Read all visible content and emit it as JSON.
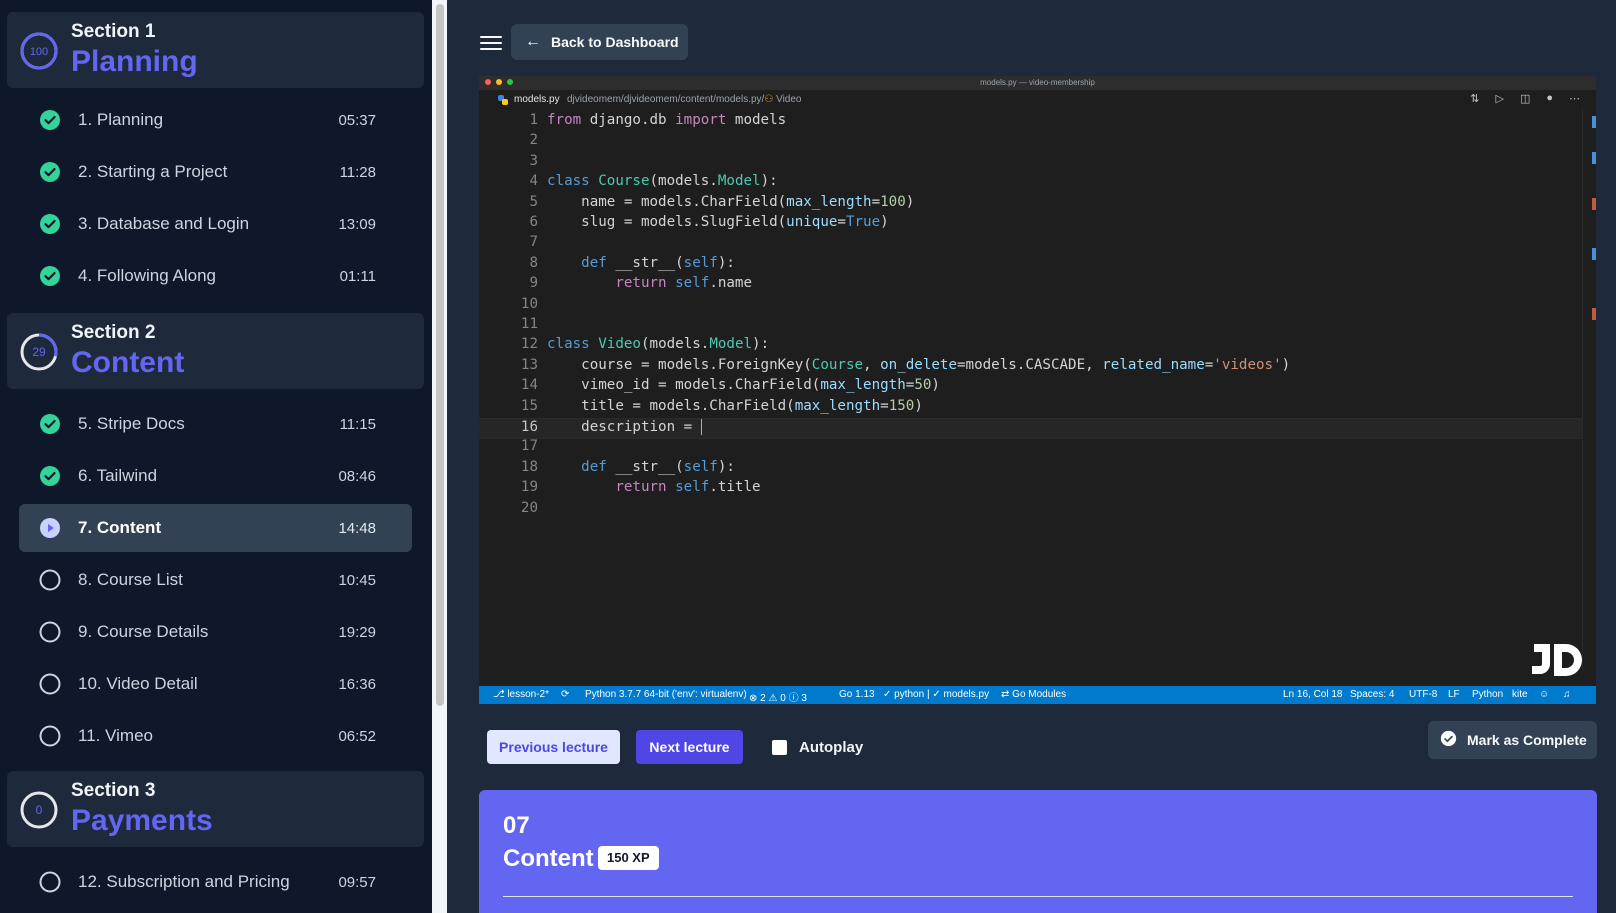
{
  "sidebar": {
    "sections": [
      {
        "progress": 100,
        "progress_label": "100",
        "kicker": "Section 1",
        "title": "Planning",
        "lessons": [
          {
            "label": "1. Planning",
            "time": "05:37",
            "status": "complete"
          },
          {
            "label": "2. Starting a Project",
            "time": "11:28",
            "status": "complete"
          },
          {
            "label": "3. Database and Login",
            "time": "13:09",
            "status": "complete"
          },
          {
            "label": "4. Following Along",
            "time": "01:11",
            "status": "complete"
          }
        ]
      },
      {
        "progress": 29,
        "progress_label": "29",
        "kicker": "Section 2",
        "title": "Content",
        "lessons": [
          {
            "label": "5. Stripe Docs",
            "time": "11:15",
            "status": "complete"
          },
          {
            "label": "6. Tailwind",
            "time": "08:46",
            "status": "complete"
          },
          {
            "label": "7. Content",
            "time": "14:48",
            "status": "current"
          },
          {
            "label": "8. Course List",
            "time": "10:45",
            "status": "incomplete"
          },
          {
            "label": "9. Course Details",
            "time": "19:29",
            "status": "incomplete"
          },
          {
            "label": "10. Video Detail",
            "time": "16:36",
            "status": "incomplete"
          },
          {
            "label": "11. Vimeo",
            "time": "06:52",
            "status": "incomplete"
          }
        ]
      },
      {
        "progress": 0,
        "progress_label": "0",
        "kicker": "Section 3",
        "title": "Payments",
        "lessons": [
          {
            "label": "12. Subscription and Pricing",
            "time": "09:57",
            "status": "incomplete"
          }
        ]
      }
    ]
  },
  "header": {
    "back_label": "Back to Dashboard",
    "menu_icon": "hamburger-menu-icon",
    "back_icon": "arrow-left-icon"
  },
  "editor": {
    "window_title": "models.py — video-membership",
    "tab_file": "models.py",
    "breadcrumb": "djvideomem/djvideomem/content/models.py/",
    "breadcrumb_symbol": "Video",
    "current_line": 16,
    "lines": [
      "from django.db import models",
      "",
      "",
      "class Course(models.Model):",
      "    name = models.CharField(max_length=100)",
      "    slug = models.SlugField(unique=True)",
      "",
      "    def __str__(self):",
      "        return self.name",
      "",
      "",
      "class Video(models.Model):",
      "    course = models.ForeignKey(Course, on_delete=models.CASCADE, related_name='videos')",
      "    vimeo_id = models.CharField(max_length=50)",
      "    title = models.CharField(max_length=150)",
      "    description = ",
      "",
      "    def __str__(self):",
      "        return self.title",
      ""
    ],
    "statusbar": {
      "branch": "lesson-2*",
      "interpreter": "Python 3.7.7 64-bit ('env': virtualenv)",
      "problems": "⊗ 2 ⚠ 0 ⓘ 3",
      "go": "Go 1.13",
      "lint": "✓ python | ✓ models.py",
      "modules": "Go Modules",
      "position": "Ln 16, Col 18",
      "spaces": "Spaces: 4",
      "encoding": "UTF-8",
      "eol": "LF",
      "language": "Python",
      "kite": "kite"
    },
    "logo_text": "JD"
  },
  "controls": {
    "prev_label": "Previous lecture",
    "next_label": "Next lecture",
    "autoplay_label": "Autoplay",
    "autoplay_checked": false,
    "mark_complete_label": "Mark as Complete"
  },
  "lecture": {
    "number": "07",
    "title": "Content",
    "xp": "150 XP"
  },
  "colors": {
    "accent": "#6366f1",
    "complete": "#34d399",
    "sidebar_bg": "#0f172a",
    "main_bg": "#1e293b"
  }
}
